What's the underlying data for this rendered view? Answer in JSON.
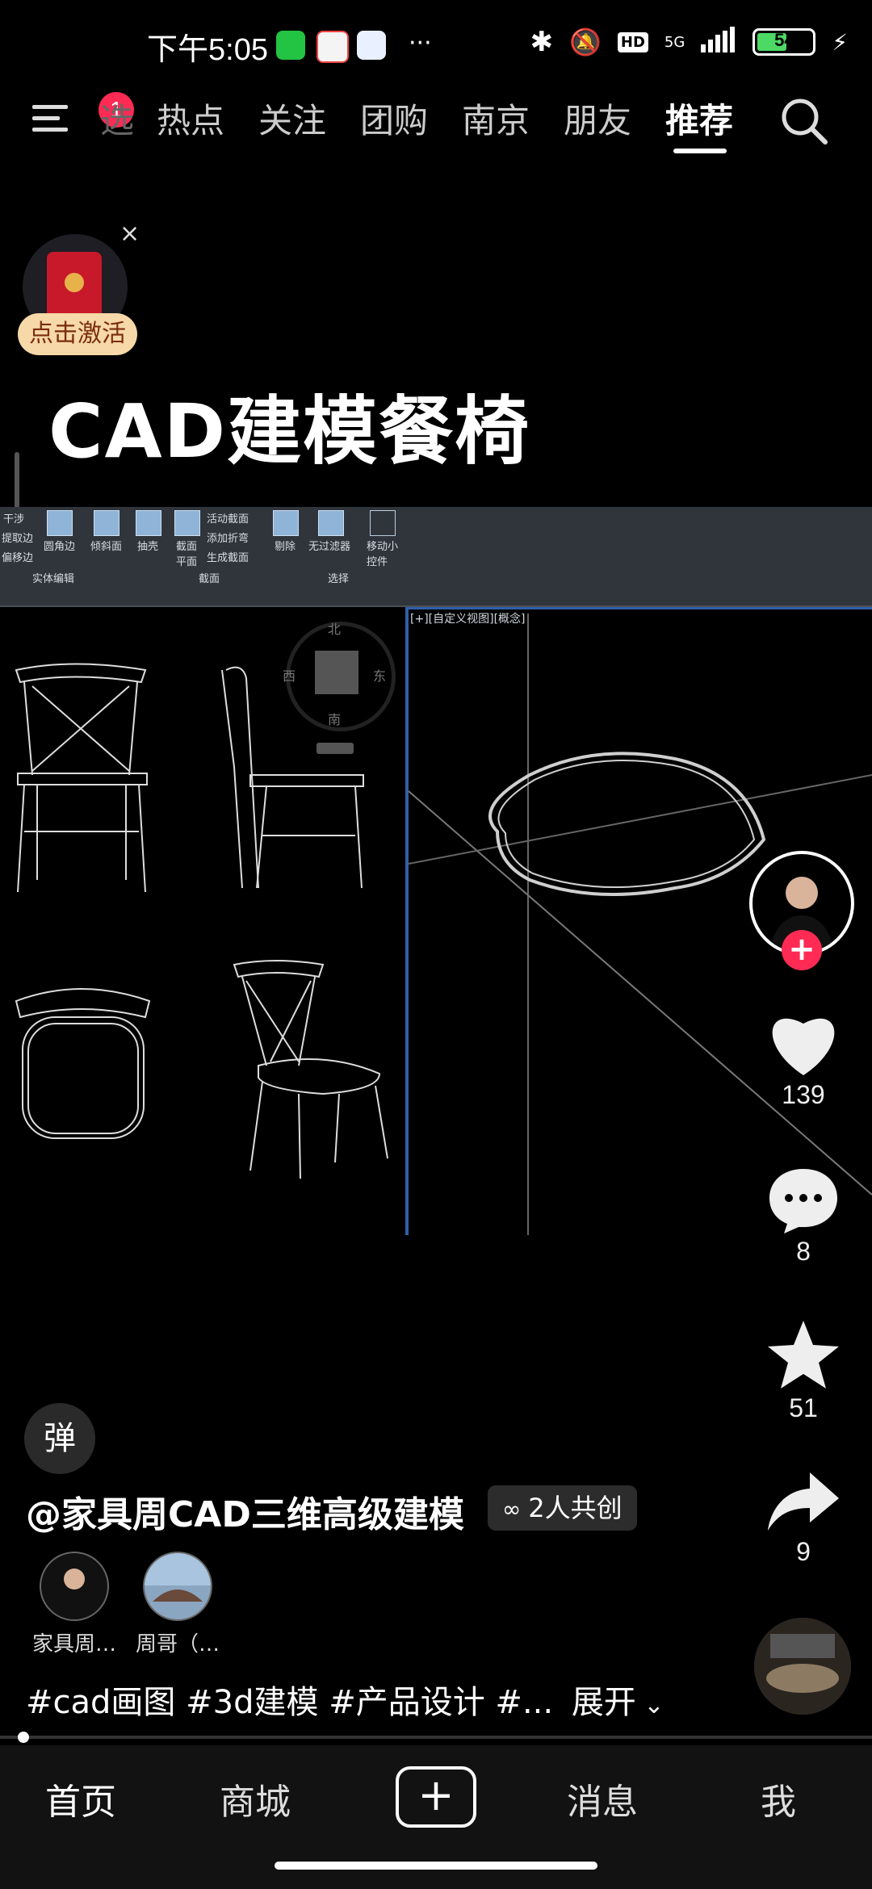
{
  "status_bar": {
    "time": "下午5:05",
    "network": "5G",
    "battery": "54",
    "battery_level": 0.54,
    "more": "···",
    "hd": "HD"
  },
  "top_nav": {
    "notification_count": "1",
    "tabs": [
      "热点",
      "关注",
      "团购",
      "南京",
      "朋友",
      "推荐"
    ],
    "active_tab": "推荐",
    "partial_tab": "选"
  },
  "promo": {
    "label": "点击激活",
    "close": "×"
  },
  "video": {
    "title": "CAD建模餐椅",
    "cad": {
      "ribbon": {
        "left_labels": [
          "干涉",
          "提取边",
          "偏移边"
        ],
        "icons": [
          "圆角边",
          "倾斜面",
          "抽壳",
          "截面平面"
        ],
        "section_items": [
          "活动截面",
          "添加折弯",
          "生成截面"
        ],
        "right_icons": [
          "剔除",
          "无过滤器",
          "移动小控件"
        ],
        "groups": [
          "实体编辑",
          "截面",
          "选择"
        ]
      },
      "viewcube": {
        "north": "北",
        "south": "南",
        "east": "东",
        "west": "西"
      },
      "viewport_label": "[+][自定义视图][概念]"
    }
  },
  "right_rail": {
    "likes": "139",
    "comments": "8",
    "favorites": "51",
    "shares": "9",
    "follow": "+"
  },
  "info": {
    "danmu": "弹",
    "author": "@家具周CAD三维高级建模",
    "co_create": "2人共创",
    "creators": [
      "家具周…",
      "周哥（…"
    ],
    "tags": "#cad画图 #3d建模 #产品设计 #...",
    "expand": "展开"
  },
  "bottom_nav": {
    "home": "首页",
    "mall": "商城",
    "create": "+",
    "messages": "消息",
    "me": "我"
  }
}
